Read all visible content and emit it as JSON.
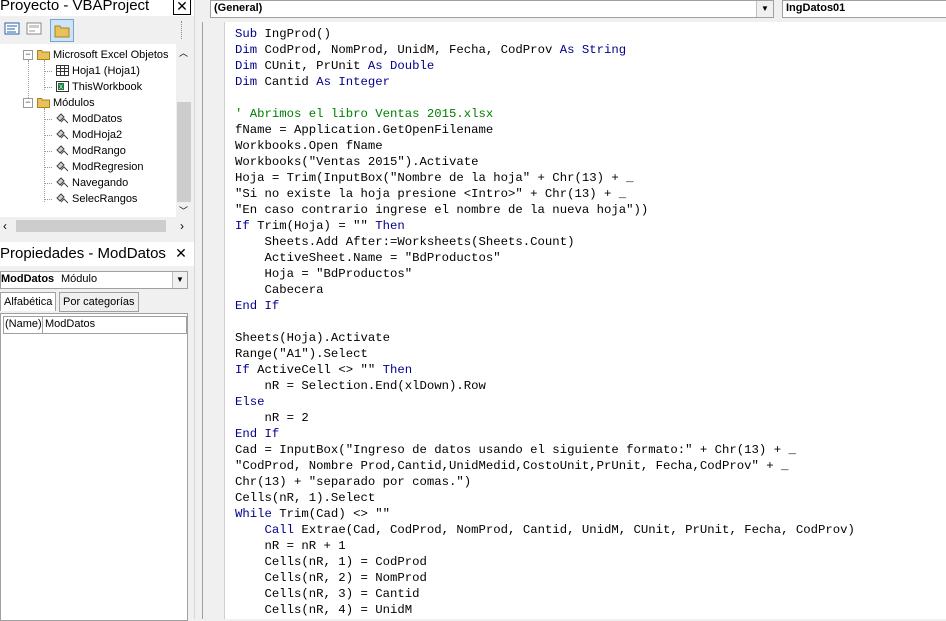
{
  "project": {
    "title": "Proyecto - VBAProject",
    "close_glyph": "✕",
    "toolbar": [
      "view-code-icon",
      "view-object-icon",
      "toggle-folders-icon"
    ],
    "tree": [
      {
        "label": "Microsoft Excel Objetos",
        "icon": "folder-icon",
        "level": 1,
        "expander": "−"
      },
      {
        "label": "Hoja1 (Hoja1)",
        "icon": "sheet-icon",
        "level": 2
      },
      {
        "label": "ThisWorkbook",
        "icon": "workbook-icon",
        "level": 2
      },
      {
        "label": "Módulos",
        "icon": "folder-icon",
        "level": 1,
        "expander": "−"
      },
      {
        "label": "ModDatos",
        "icon": "module-icon",
        "level": 2
      },
      {
        "label": "ModHoja2",
        "icon": "module-icon",
        "level": 2
      },
      {
        "label": "ModRango",
        "icon": "module-icon",
        "level": 2
      },
      {
        "label": "ModRegresion",
        "icon": "module-icon",
        "level": 2
      },
      {
        "label": "Navegando",
        "icon": "module-icon",
        "level": 2
      },
      {
        "label": "SelecRangos",
        "icon": "module-icon",
        "level": 2
      }
    ]
  },
  "properties": {
    "title": "Propiedades - ModDatos",
    "close_glyph": "✕",
    "object_name": "ModDatos",
    "object_type": "Módulo",
    "tabs": [
      "Alfabética",
      "Por categorías"
    ],
    "rows": [
      {
        "name": "(Name)",
        "value": "ModDatos"
      }
    ]
  },
  "code": {
    "object_combo": "(General)",
    "proc_combo": "IngDatos01",
    "lines": [
      [
        [
          "kw",
          "Sub "
        ],
        [
          "t",
          "IngProd()"
        ]
      ],
      [
        [
          "kw",
          "Dim "
        ],
        [
          "t",
          "CodProd, NomProd, UnidM, Fecha, CodProv "
        ],
        [
          "kw",
          "As String"
        ]
      ],
      [
        [
          "kw",
          "Dim "
        ],
        [
          "t",
          "CUnit, PrUnit "
        ],
        [
          "kw",
          "As Double"
        ]
      ],
      [
        [
          "kw",
          "Dim "
        ],
        [
          "t",
          "Cantid "
        ],
        [
          "kw",
          "As Integer"
        ]
      ],
      [],
      [
        [
          "cm",
          "' Abrimos el libro Ventas 2015.xlsx"
        ]
      ],
      [
        [
          "t",
          "fName = Application.GetOpenFilename"
        ]
      ],
      [
        [
          "t",
          "Workbooks.Open fName"
        ]
      ],
      [
        [
          "t",
          "Workbooks(\"Ventas 2015\").Activate"
        ]
      ],
      [
        [
          "t",
          "Hoja = Trim(InputBox(\"Nombre de la hoja\" + Chr(13) + _"
        ]
      ],
      [
        [
          "t",
          "\"Si no existe la hoja presione <Intro>\" + Chr(13) + _"
        ]
      ],
      [
        [
          "t",
          "\"En caso contrario ingrese el nombre de la nueva hoja\"))"
        ]
      ],
      [
        [
          "kw",
          "If "
        ],
        [
          "t",
          "Trim(Hoja) = \"\" "
        ],
        [
          "kw",
          "Then"
        ]
      ],
      [
        [
          "t",
          "    Sheets.Add After:=Worksheets(Sheets.Count)"
        ]
      ],
      [
        [
          "t",
          "    ActiveSheet.Name = \"BdProductos\""
        ]
      ],
      [
        [
          "t",
          "    Hoja = \"BdProductos\""
        ]
      ],
      [
        [
          "t",
          "    Cabecera"
        ]
      ],
      [
        [
          "kw",
          "End If"
        ]
      ],
      [],
      [
        [
          "t",
          "Sheets(Hoja).Activate"
        ]
      ],
      [
        [
          "t",
          "Range(\"A1\").Select"
        ]
      ],
      [
        [
          "kw",
          "If "
        ],
        [
          "t",
          "ActiveCell <> \"\" "
        ],
        [
          "kw",
          "Then"
        ]
      ],
      [
        [
          "t",
          "    nR = Selection.End(xlDown).Row"
        ]
      ],
      [
        [
          "kw",
          "Else"
        ]
      ],
      [
        [
          "t",
          "    nR = 2"
        ]
      ],
      [
        [
          "kw",
          "End If"
        ]
      ],
      [
        [
          "t",
          "Cad = InputBox(\"Ingreso de datos usando el siguiente formato:\" + Chr(13) + _"
        ]
      ],
      [
        [
          "t",
          "\"CodProd, Nombre Prod,Cantid,UnidMedid,CostoUnit,PrUnit, Fecha,CodProv\" + _"
        ]
      ],
      [
        [
          "t",
          "Chr(13) + \"separado por comas.\")"
        ]
      ],
      [
        [
          "t",
          "Cells(nR, 1).Select"
        ]
      ],
      [
        [
          "kw",
          "While "
        ],
        [
          "t",
          "Trim(Cad) <> \"\""
        ]
      ],
      [
        [
          "t",
          "    "
        ],
        [
          "kw",
          "Call "
        ],
        [
          "t",
          "Extrae(Cad, CodProd, NomProd, Cantid, UnidM, CUnit, PrUnit, Fecha, CodProv)"
        ]
      ],
      [
        [
          "t",
          "    nR = nR + 1"
        ]
      ],
      [
        [
          "t",
          "    Cells(nR, 1) = CodProd"
        ]
      ],
      [
        [
          "t",
          "    Cells(nR, 2) = NomProd"
        ]
      ],
      [
        [
          "t",
          "    Cells(nR, 3) = Cantid"
        ]
      ],
      [
        [
          "t",
          "    Cells(nR, 4) = UnidM"
        ]
      ]
    ]
  },
  "colors": {
    "keyword": "#00008b",
    "comment": "#008000",
    "text": "#000000"
  }
}
